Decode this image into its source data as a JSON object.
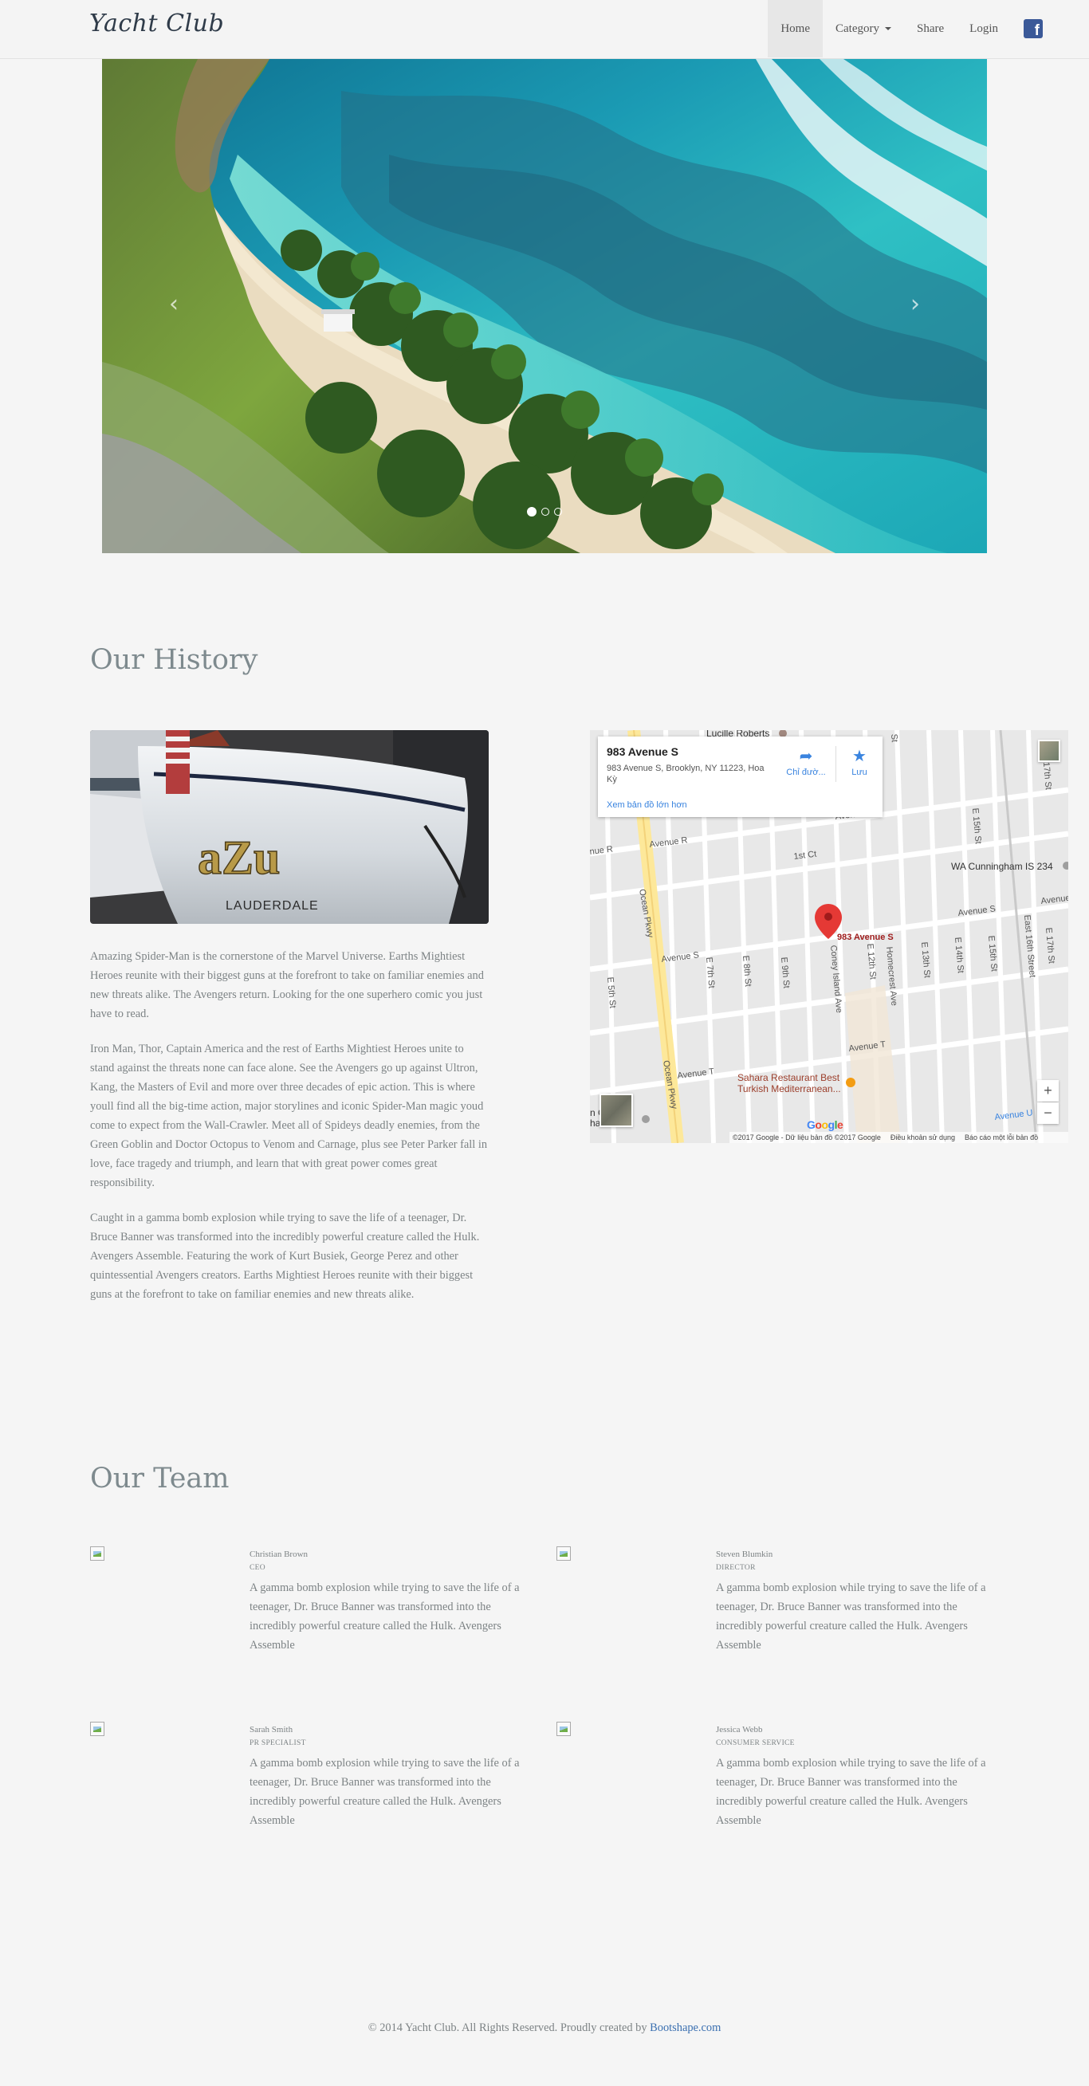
{
  "navbar": {
    "brand": "Yacht Club",
    "items": [
      {
        "label": "Home",
        "active": true
      },
      {
        "label": "Category",
        "dropdown": true
      },
      {
        "label": "Share"
      },
      {
        "label": "Login"
      }
    ],
    "social_icon": "facebook-icon",
    "social_glyph": "f"
  },
  "carousel": {
    "slide_count": 3,
    "active_slide": 1,
    "prev_glyph": "‹",
    "next_glyph": "›"
  },
  "history": {
    "title": "Our History",
    "boat_name": "aZu",
    "boat_port": "LAUDERDALE",
    "paragraphs": [
      "Amazing Spider-Man is the cornerstone of the Marvel Universe. Earths Mightiest Heroes reunite with their biggest guns at the forefront to take on familiar enemies and new threats alike. The Avengers return. Looking for the one superhero comic you just have to read.",
      "Iron Man, Thor, Captain America and the rest of Earths Mightiest Heroes unite to stand against the threats none can face alone. See the Avengers go up against Ultron, Kang, the Masters of Evil and more over three decades of epic action. This is where youll find all the big-time action, major storylines and iconic Spider-Man magic youd come to expect from the Wall-Crawler. Meet all of Spideys deadly enemies, from the Green Goblin and Doctor Octopus to Venom and Carnage, plus see Peter Parker fall in love, face tragedy and triumph, and learn that with great power comes great responsibility.",
      "Caught in a gamma bomb explosion while trying to save the life of a teenager, Dr. Bruce Banner was transformed into the incredibly powerful creature called the Hulk. Avengers Assemble. Featuring the work of Kurt Busiek, George Perez and other quintessential Avengers creators. Earths Mightiest Heroes reunite with their biggest guns at the forefront to take on familiar enemies and new threats alike."
    ]
  },
  "map": {
    "place_title": "983 Avenue S",
    "place_address": "983 Avenue S, Brooklyn, NY 11223, Hoa Kỳ",
    "directions_label": "Chỉ đườ...",
    "save_label": "Lưu",
    "larger_map_label": "Xem bản đồ lớn hơn",
    "marker_label": "983 Avenue S",
    "labels": {
      "lucille": "Lucille Roberts",
      "wa": "WA Cunningham IS 234",
      "sahara1": "Sahara Restaurant Best",
      "sahara2": "Turkish Mediterranean...",
      "ocean1": "Ocean Pkwy",
      "ocean2": "Ocean Pkwy",
      "coney": "Coney Island Ave",
      "homecrest": "Homecrest Ave",
      "ave_r": "nue R",
      "ave_r2": "Avenue R",
      "first_ct": "1st Ct",
      "avenue": "Avenue",
      "ave_s1": "Avenue S",
      "ave_s2": "Avenue S",
      "ave_s3": "Avenue S",
      "ave_t1": "Avenue T",
      "ave_t2": "Avenue T",
      "ave_u": "Avenue U",
      "e5": "E 5th St",
      "e7": "E 7th St",
      "e8": "E 8th St",
      "e9": "E 9th St",
      "e12": "E 12th St",
      "e13": "E 13th St",
      "e14": "E 14th St",
      "e15": "E 15th St",
      "e15b": "E 15th St",
      "e16": "East 16th Street",
      "e17": "E 17th St",
      "e17b": "E 17th St",
      "st": "St",
      "sw1": "n Gen",
      "sw2": "hare Zion"
    },
    "zoom_in": "+",
    "zoom_out": "−",
    "google": "Google",
    "footer": {
      "data": "©2017 Google - Dữ liệu bản đồ ©2017 Google",
      "terms": "Điều khoản sử dụng",
      "report": "Báo cáo một lỗi bản đồ"
    }
  },
  "team": {
    "title": "Our Team",
    "members": [
      {
        "name": "Christian Brown",
        "role": "CEO",
        "bio": "A gamma bomb explosion while trying to save the life of a teenager, Dr. Bruce Banner was transformed into the incredibly powerful creature called the Hulk. Avengers Assemble"
      },
      {
        "name": "Steven Blumkin",
        "role": "DIRECTOR",
        "bio": "A gamma bomb explosion while trying to save the life of a teenager, Dr. Bruce Banner was transformed into the incredibly powerful creature called the Hulk. Avengers Assemble"
      },
      {
        "name": "Sarah Smith",
        "role": "PR SPECIALIST",
        "bio": "A gamma bomb explosion while trying to save the life of a teenager, Dr. Bruce Banner was transformed into the incredibly powerful creature called the Hulk. Avengers Assemble"
      },
      {
        "name": "Jessica Webb",
        "role": "CONSUMER SERVICE",
        "bio": "A gamma bomb explosion while trying to save the life of a teenager, Dr. Bruce Banner was transformed into the incredibly powerful creature called the Hulk. Avengers Assemble"
      }
    ]
  },
  "footer": {
    "text": "© 2014 Yacht Club. All Rights Reserved. Proudly created by ",
    "link": "Bootshape.com"
  },
  "colors": {
    "background": "#f5f5f5",
    "brand": "#2f3b49",
    "text": "#7d8385",
    "link": "#3a6fb0",
    "facebook": "#3b5998"
  }
}
